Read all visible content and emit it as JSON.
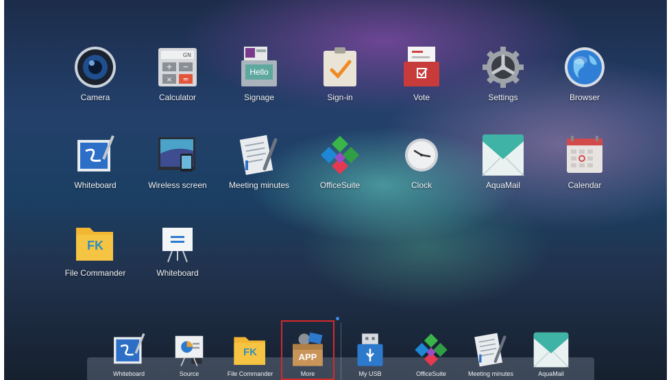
{
  "launcher": {
    "apps": [
      {
        "label": "Camera",
        "icon": "camera-icon"
      },
      {
        "label": "Calculator",
        "icon": "calculator-icon"
      },
      {
        "label": "Signage",
        "icon": "signage-icon",
        "icon_text": "Hello"
      },
      {
        "label": "Sign-in",
        "icon": "sign-in-icon"
      },
      {
        "label": "Vote",
        "icon": "vote-icon"
      },
      {
        "label": "Settings",
        "icon": "settings-icon"
      },
      {
        "label": "Browser",
        "icon": "browser-icon"
      },
      {
        "label": "Whiteboard",
        "icon": "whiteboard-icon"
      },
      {
        "label": "Wireless screen",
        "icon": "wireless-screen-icon"
      },
      {
        "label": "Meeting minutes",
        "icon": "meeting-minutes-icon"
      },
      {
        "label": "OfficeSuite",
        "icon": "officesuite-icon"
      },
      {
        "label": "Clock",
        "icon": "clock-icon"
      },
      {
        "label": "AquaMail",
        "icon": "aquamail-icon"
      },
      {
        "label": "Calendar",
        "icon": "calendar-icon"
      },
      {
        "label": "File Commander",
        "icon": "file-commander-icon",
        "icon_text": "FK"
      },
      {
        "label": "Whiteboard",
        "icon": "whiteboard-easel-icon"
      }
    ]
  },
  "dock": {
    "items": [
      {
        "label": "Whiteboard",
        "icon": "whiteboard-icon"
      },
      {
        "label": "Source",
        "icon": "source-icon"
      },
      {
        "label": "File Commander",
        "icon": "file-commander-icon",
        "icon_text": "FK"
      },
      {
        "label": "More",
        "icon": "app-box-icon",
        "icon_text": "APP",
        "selected": true
      },
      {
        "label": "My USB",
        "icon": "usb-icon"
      },
      {
        "label": "OfficeSuite",
        "icon": "officesuite-icon"
      },
      {
        "label": "Meeting minutes",
        "icon": "meeting-minutes-icon"
      },
      {
        "label": "AquaMail",
        "icon": "aquamail-icon"
      }
    ]
  },
  "colors": {
    "selection_border": "#d62a2a",
    "page_indicator": "#3d8ae8",
    "folder_yellow": "#f2b632",
    "teal": "#3fb3a5"
  }
}
